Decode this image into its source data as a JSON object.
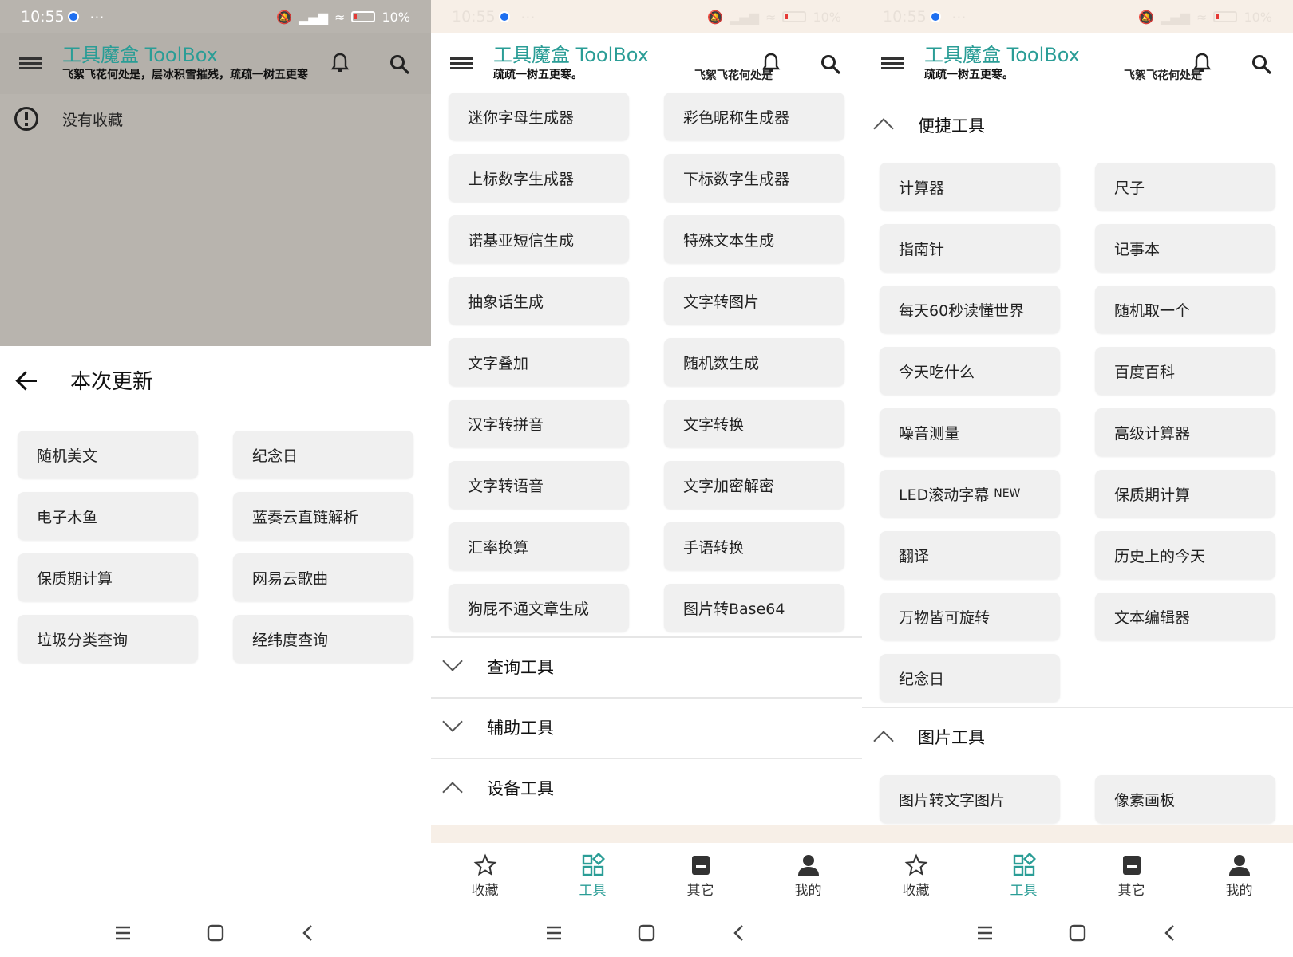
{
  "status": {
    "time": "10:55",
    "more": "···",
    "battery": "10%"
  },
  "app": {
    "title": "工具魔盒 ToolBox",
    "subtitle_full": "飞絮飞花何处是，层冰积雪摧残，疏疏一树五更寒",
    "subtitle_left": "疏疏一树五更寒。",
    "subtitle_right": "飞絮飞花何处是"
  },
  "panel1": {
    "empty_favorites": "没有收藏",
    "sheet_title": "本次更新",
    "updates": [
      "随机美文",
      "纪念日",
      "电子木鱼",
      "蓝奏云直链解析",
      "保质期计算",
      "网易云歌曲",
      "垃圾分类查询",
      "经纬度查询"
    ]
  },
  "panel2": {
    "tools": [
      "迷你字母生成器",
      "彩色昵称生成器",
      "上标数字生成器",
      "下标数字生成器",
      "诺基亚短信生成",
      "特殊文本生成",
      "抽象话生成",
      "文字转图片",
      "文字叠加",
      "随机数生成",
      "汉字转拼音",
      "文字转换",
      "文字转语音",
      "文字加密解密",
      "汇率换算",
      "手语转换",
      "狗屁不通文章生成",
      "图片转Base64"
    ],
    "sections": [
      "查询工具",
      "辅助工具",
      "设备工具"
    ]
  },
  "panel3": {
    "section_quick": "便捷工具",
    "quick_tools": [
      "计算器",
      "尺子",
      "指南针",
      "记事本",
      "每天60秒读懂世界",
      "随机取一个",
      "今天吃什么",
      "百度百科",
      "噪音测量",
      "高级计算器",
      "LED滚动字幕",
      "保质期计算",
      "翻译",
      "历史上的今天",
      "万物皆可旋转",
      "文本编辑器",
      "纪念日"
    ],
    "new_badge": "NEW",
    "section_image": "图片工具",
    "image_tools": [
      "图片转文字图片",
      "像素画板"
    ]
  },
  "nav": [
    "收藏",
    "工具",
    "其它",
    "我的"
  ],
  "colors": {
    "accent": "#2a9d96",
    "dim_overlay": "#b8b4ae",
    "button_bg": "#f0f0f0",
    "cream": "#f7efe7"
  }
}
